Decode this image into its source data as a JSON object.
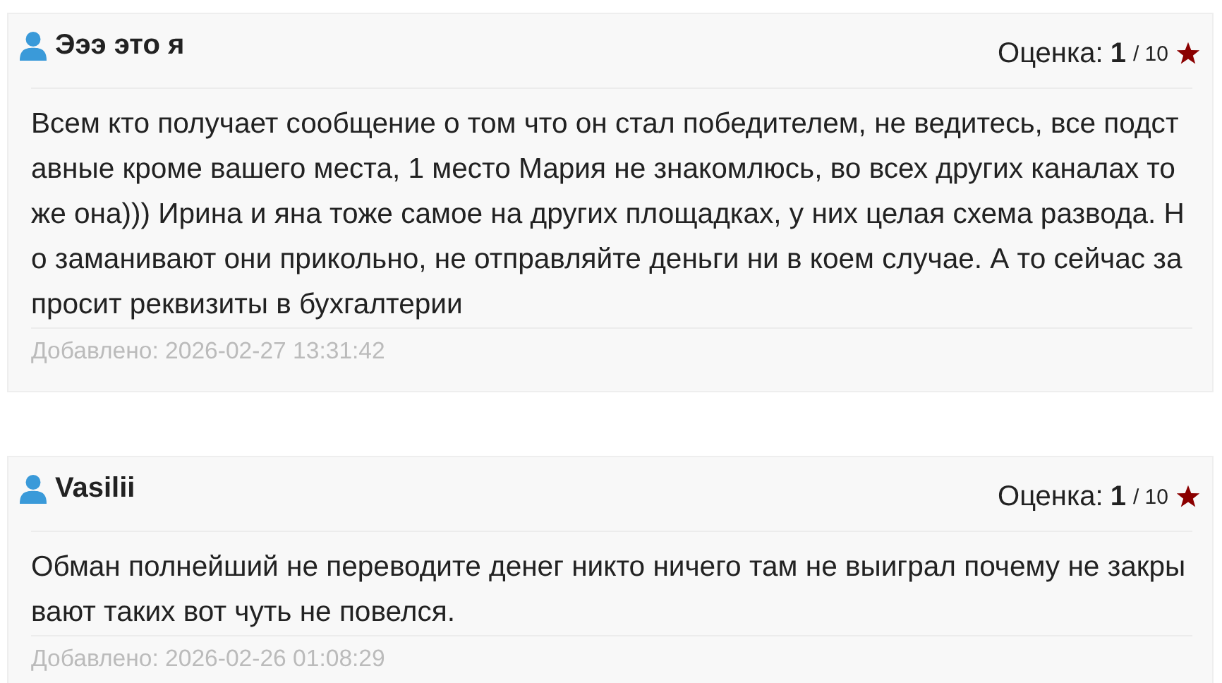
{
  "reviews": [
    {
      "author": "Эээ это я",
      "rating_label": "Оценка:",
      "rating": "1",
      "rating_max": "/ 10",
      "text": "Всем кто получает сообщение о том что он стал победителем, не ведитесь, все подставные кроме вашего места, 1 место Мария не знакомлюсь, во всех других каналах тоже она))) Ирина и яна тоже самое на других площадках, у них целая схема развода. Но заманивают они прикольно, не отправляйте деньги ни в коем случае. А то сейчас запросит реквизиты в бухгалтерии",
      "added": "Добавлено: 2026-02-27 13:31:42"
    },
    {
      "author": "Vasilii",
      "rating_label": "Оценка:",
      "rating": "1",
      "rating_max": "/ 10",
      "text": "Обман полнейший не переводите денег никто ничего там не выиграл почему не закрывают таких вот чуть не повелся.",
      "added": "Добавлено: 2026-02-26 01:08:29"
    }
  ]
}
